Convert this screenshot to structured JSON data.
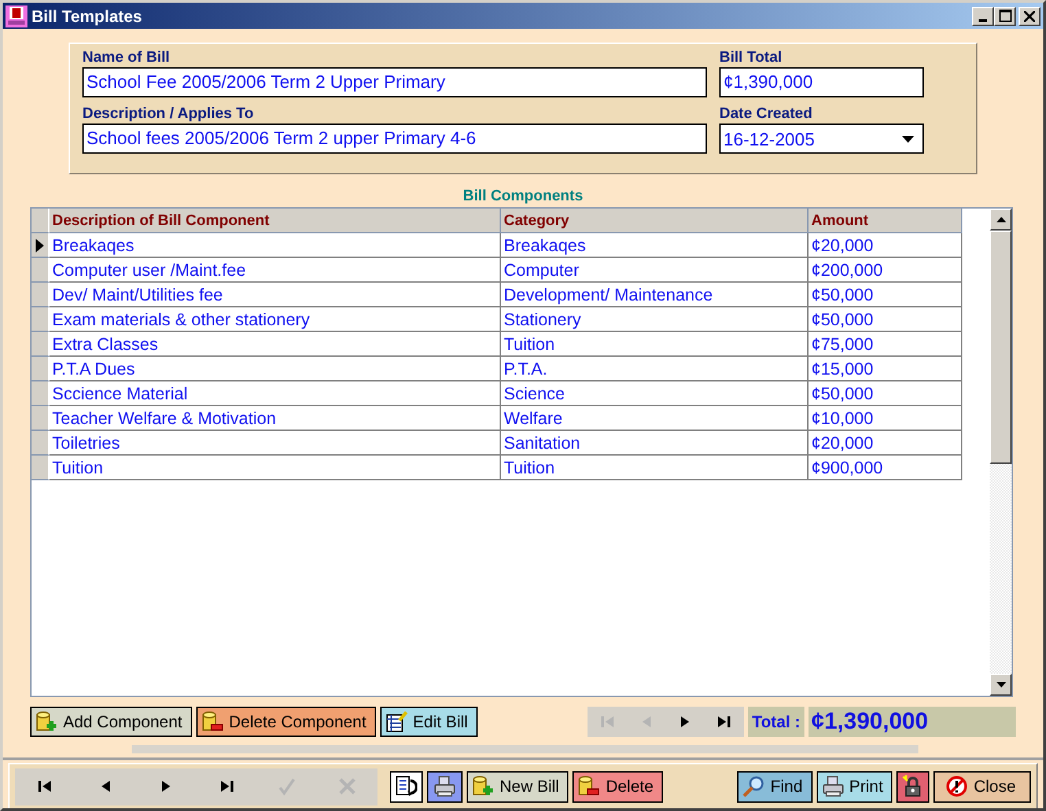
{
  "window": {
    "title": "Bill Templates"
  },
  "form": {
    "name_label": "Name of Bill",
    "name_value": "School Fee 2005/2006 Term 2 Upper Primary",
    "total_label": "Bill Total",
    "total_value": "¢1,390,000",
    "description_label": "Description / Applies To",
    "description_value": "School fees 2005/2006 Term 2 upper Primary 4-6",
    "date_label": "Date Created",
    "date_value": "16-12-2005"
  },
  "components": {
    "title": "Bill Components",
    "columns": [
      "Description of Bill Component",
      "Category",
      "Amount"
    ],
    "rows": [
      {
        "description": "Breakaqes",
        "category": "Breakaqes",
        "amount": "¢20,000",
        "selected": true
      },
      {
        "description": "Computer user /Maint.fee",
        "category": "Computer",
        "amount": "¢200,000",
        "selected": false
      },
      {
        "description": "Dev/ Maint/Utilities fee",
        "category": "Development/ Maintenance",
        "amount": "¢50,000",
        "selected": false
      },
      {
        "description": "Exam materials & other stationery",
        "category": "Stationery",
        "amount": "¢50,000",
        "selected": false
      },
      {
        "description": "Extra Classes",
        "category": "Tuition",
        "amount": "¢75,000",
        "selected": false
      },
      {
        "description": "P.T.A Dues",
        "category": "P.T.A.",
        "amount": "¢15,000",
        "selected": false
      },
      {
        "description": "Sccience  Material",
        "category": "Science",
        "amount": "¢50,000",
        "selected": false
      },
      {
        "description": "Teacher Welfare & Motivation",
        "category": "Welfare",
        "amount": "¢10,000",
        "selected": false
      },
      {
        "description": "Toiletries",
        "category": "Sanitation",
        "amount": "¢20,000",
        "selected": false
      },
      {
        "description": "Tuition",
        "category": "Tuition",
        "amount": "¢900,000",
        "selected": false
      }
    ]
  },
  "component_buttons": [
    {
      "kind": "add",
      "label": "Add Component"
    },
    {
      "kind": "delete",
      "label": "Delete Component"
    },
    {
      "kind": "edit",
      "label": "Edit Bill"
    }
  ],
  "grid_nav": [
    {
      "kind": "first",
      "disabled": true
    },
    {
      "kind": "prev",
      "disabled": true
    },
    {
      "kind": "next",
      "disabled": false
    },
    {
      "kind": "last",
      "disabled": false
    }
  ],
  "total": {
    "label": "Total :",
    "value": "¢1,390,000"
  },
  "toolbar": {
    "nav": [
      {
        "kind": "first",
        "disabled": false
      },
      {
        "kind": "prev",
        "disabled": false
      },
      {
        "kind": "next",
        "disabled": false
      },
      {
        "kind": "last",
        "disabled": false
      },
      {
        "kind": "save",
        "disabled": true
      },
      {
        "kind": "cancel",
        "disabled": true
      }
    ],
    "buttons": [
      {
        "kind": "undo"
      },
      {
        "kind": "preview"
      },
      {
        "kind": "new",
        "label": "New Bill"
      },
      {
        "kind": "remove",
        "label": "Delete"
      }
    ],
    "right_buttons": [
      {
        "kind": "find",
        "label": "Find"
      },
      {
        "kind": "print",
        "label": "Print"
      },
      {
        "kind": "lock"
      },
      {
        "kind": "close",
        "label": "Close"
      }
    ]
  }
}
